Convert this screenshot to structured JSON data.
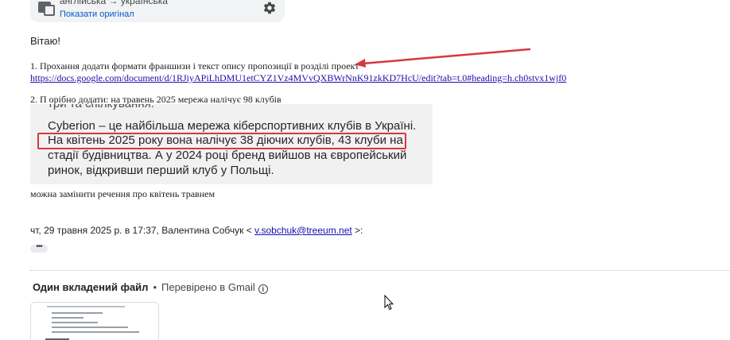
{
  "translate_bar": {
    "languages": "англійська → українська",
    "show_original": "Показати оригінал"
  },
  "message": {
    "greeting": "Вітаю!",
    "item1_text": "1. Прохання додати формати франшизи і текст опису пропозиції в розділі проект",
    "item1_link": "https://docs.google.com/document/d/1RJiyAPiLhDMU1etCYZ1Vz4MVvQXBWrNnK91zkKD7HcU/edit?tab=t.0#heading=h.ch0stvx1wjf0",
    "item2_text": "2. П орібно додати: на травень 2025 мережа налічує 98 клубів",
    "quote": {
      "cut_line": "три та спілкування.",
      "line1": "Cyberion – це найбільша мережа кіберспортивних клубів в Україні.",
      "line2": "На квітень 2025 року вона налічує 38 діючих клубів, 43 клуби на",
      "line3": "стадії будівництва. А у 2024 році бренд вийшов на європейський",
      "line4": "ринок, відкривши перший клуб у Польщі."
    },
    "item3_text": "можна замінити речення про квітень травнем"
  },
  "quoted_meta": {
    "prefix": "чт, 29 травня 2025 р. в 17:37, Валентина Собчук < ",
    "email": "v.sobchuk@treeum.net",
    "suffix": " >:"
  },
  "expand_dots": "•••",
  "attachments": {
    "count_label": "Один вкладений файл",
    "separator": "•",
    "scan_label": "Перевірено в Gmail",
    "info_glyph": "i"
  },
  "colors": {
    "annotation_red": "#d9363e",
    "link_blue": "#1a0dab",
    "accent_blue": "#0b57d0"
  }
}
